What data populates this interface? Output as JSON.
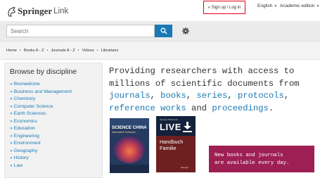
{
  "header": {
    "logo_brand": "Springer",
    "logo_product": "Link",
    "signup_login": "» Sign up / Log in",
    "language": "English",
    "edition": "Academic edition"
  },
  "search": {
    "placeholder": "Search"
  },
  "breadcrumb": [
    "Home",
    "Books A - Z",
    "Journals A - Z",
    "Videos",
    "Librarians"
  ],
  "sidebar": {
    "title": "Browse by discipline",
    "items": [
      "» Biomedicine",
      "» Business and Management",
      "» Chemistry",
      "» Computer Science",
      "» Earth Sciences",
      "» Economics",
      "» Education",
      "» Engineering",
      "» Environment",
      "» Geography",
      "» History",
      "» Law"
    ]
  },
  "tagline": {
    "l1": "Providing researchers with access to",
    "l2": "millions of scientific documents from",
    "journals": "journals",
    "books": "books",
    "series": "series",
    "protocols": "protocols",
    "reference_works": "reference works",
    "proceedings": "proceedings",
    "comma": ",",
    "and": "and",
    "period": "."
  },
  "books": {
    "science_china": {
      "title": "SCIENCE CHINA",
      "subtitle": "Information Sciences"
    },
    "live": {
      "mini": "Springer Reference",
      "brand": "LIVE",
      "title_l1": "Handbuch",
      "title_l2": "Familie",
      "publisher": "Springer"
    }
  },
  "promo": {
    "l1": "New books and journals",
    "l2": "are available every day."
  },
  "colors": {
    "accent_blue": "#1a79b5",
    "highlight_red": "#e3001b",
    "promo_magenta": "#9e1f53"
  }
}
